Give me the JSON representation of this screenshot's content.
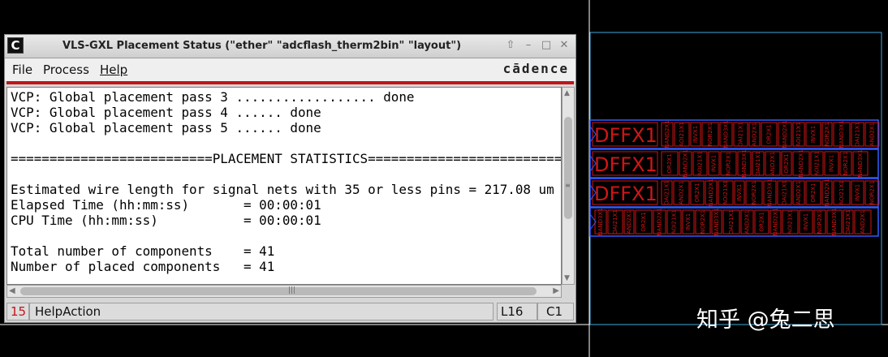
{
  "window": {
    "title": "VLS-GXL Placement Status (\"ether\" \"adcflash_therm2bin\" \"layout\")",
    "app_icon_glyph": "C",
    "controls": {
      "up": "⇧",
      "minimize": "–",
      "maximize": "□",
      "close": "✕"
    }
  },
  "menu": {
    "items": [
      "File",
      "Process",
      "Help"
    ],
    "logo": "cādence"
  },
  "log": {
    "lines": [
      "VCP: Global placement pass 3 .................. done",
      "VCP: Global placement pass 4 ...... done",
      "VCP: Global placement pass 5 ...... done",
      "",
      "==========================PLACEMENT STATISTICS===========================",
      "",
      "Estimated wire length for signal nets with 35 or less pins = 217.08 um",
      "Elapsed Time (hh:mm:ss)       = 00:00:01",
      "CPU Time (hh:mm:ss)           = 00:00:01",
      "",
      "Total number of components    = 41",
      "Number of placed components   = 41"
    ]
  },
  "scrollbars": {
    "up": "▲",
    "down": "▼",
    "left": "◀",
    "right": "▶",
    "grip_v": "≡",
    "grip_h": "|||"
  },
  "statusbar": {
    "line_number": "15",
    "message": "HelpAction",
    "line": "L16",
    "column": "C1"
  },
  "layout_canvas": {
    "row_labels": [
      "DFFX1",
      "DFFX1",
      "DFFX1"
    ],
    "cell_names": [
      "NAND2X1",
      "AOI21X1",
      "INVX1",
      "NOR2X1",
      "NAND3X1",
      "OAI21X1",
      "AND2X1",
      "OR2X1"
    ],
    "colors": {
      "cell_outline": "#d01515",
      "row_outline": "#2f5cff",
      "boundary": "#3fa7e0",
      "background": "#000000"
    }
  },
  "watermark": "知乎 @兔二思"
}
